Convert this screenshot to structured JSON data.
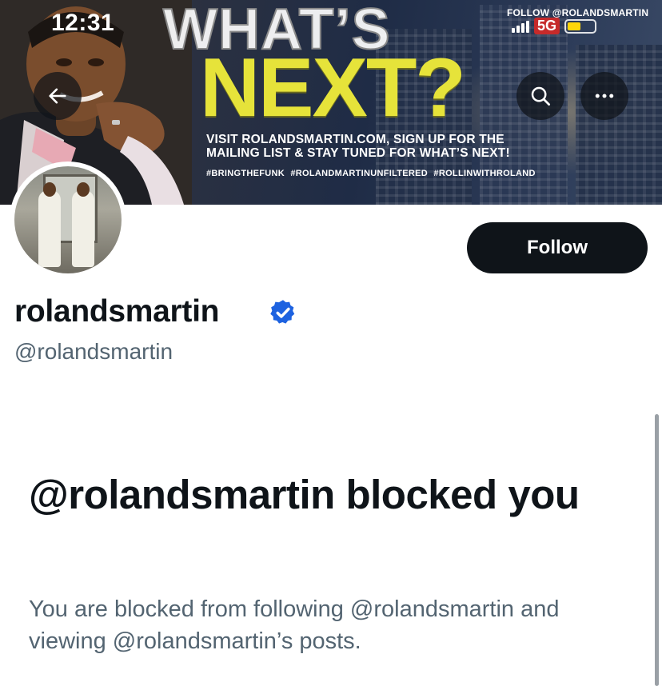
{
  "status_bar": {
    "time": "12:31",
    "network": "5G"
  },
  "banner": {
    "headline_top": "WHAT’S",
    "headline_bottom": "NEXT?",
    "follow_handle": "FOLLOW @ROLANDSMARTIN",
    "promo_line1": "VISIT ROLANDSMARTIN.COM, SIGN UP FOR THE",
    "promo_line2": "MAILING LIST & STAY TUNED FOR WHAT’S NEXT!",
    "hashtags": "#BRINGTHEFUNK #ROLANDMARTINUNFILTERED #ROLLINWITHROLAND"
  },
  "nav": {
    "back_icon": "arrow-left-icon",
    "search_icon": "search-icon",
    "more_icon": "more-horizontal-icon"
  },
  "profile": {
    "display_name": "rolandsmartin",
    "handle": "@rolandsmartin",
    "verified_color": "#1d9bf0",
    "follow_label": "Follow"
  },
  "blocked": {
    "title": "@rolandsmartin blocked you",
    "description": "You are blocked from following @rolandsmartin and viewing @rolandsmartin’s posts."
  },
  "colors": {
    "primary_text": "#0f1419",
    "secondary_text": "#536471",
    "banner_accent": "#e6e33a",
    "verified_badge": "#1d9bf0"
  }
}
